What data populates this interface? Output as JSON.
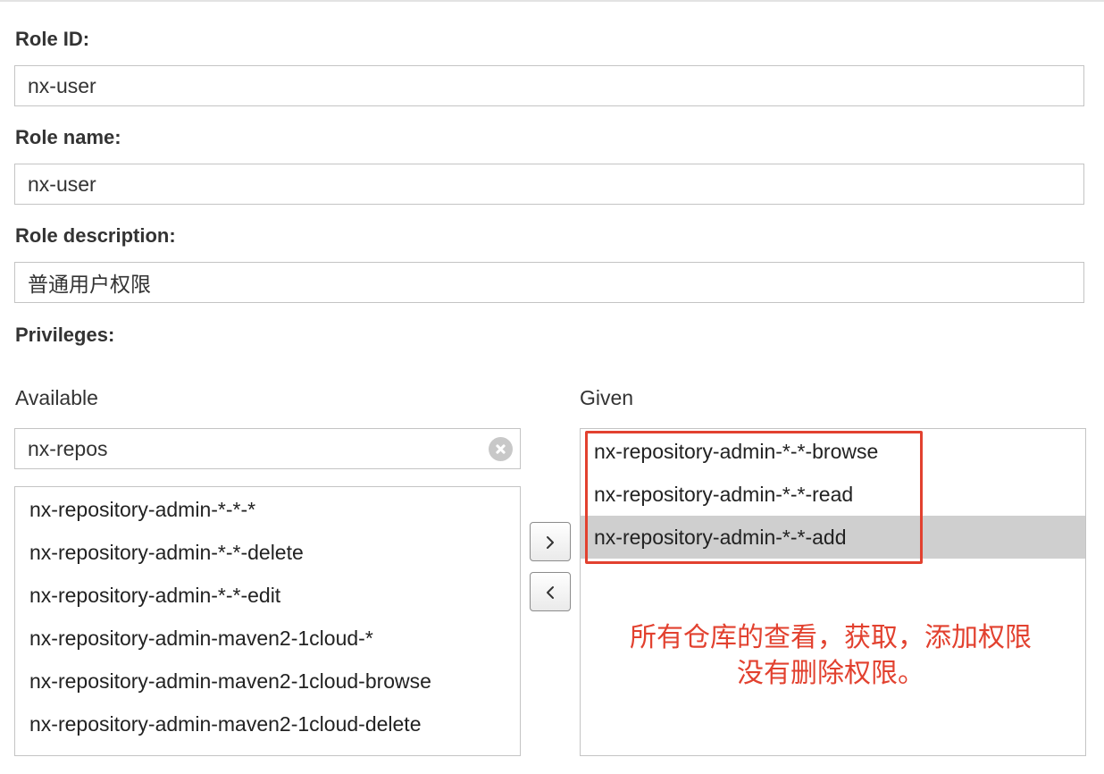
{
  "form": {
    "role_id": {
      "label": "Role ID:",
      "value": "nx-user"
    },
    "role_name": {
      "label": "Role name:",
      "value": "nx-user"
    },
    "role_description": {
      "label": "Role description:",
      "value": "普通用户权限"
    },
    "privileges_label": "Privileges:"
  },
  "privileges": {
    "available_label": "Available",
    "given_label": "Given",
    "filter_value": "nx-repos",
    "available_items": [
      "nx-repository-admin-*-*-*",
      "nx-repository-admin-*-*-delete",
      "nx-repository-admin-*-*-edit",
      "nx-repository-admin-maven2-1cloud-*",
      "nx-repository-admin-maven2-1cloud-browse",
      "nx-repository-admin-maven2-1cloud-delete"
    ],
    "given_items": [
      "nx-repository-admin-*-*-browse",
      "nx-repository-admin-*-*-read",
      "nx-repository-admin-*-*-add"
    ],
    "selected_given": "nx-repository-admin-*-*-add",
    "add_button": "›",
    "remove_button": "‹"
  },
  "annotation": {
    "line1": "所有仓库的查看，获取，添加权限",
    "line2": "没有删除权限。",
    "color": "#e2412f"
  },
  "colors": {
    "text": "#333333",
    "border": "#c4c4c4",
    "selected_row": "#cfcfcf",
    "annotation_red": "#e2412f"
  }
}
